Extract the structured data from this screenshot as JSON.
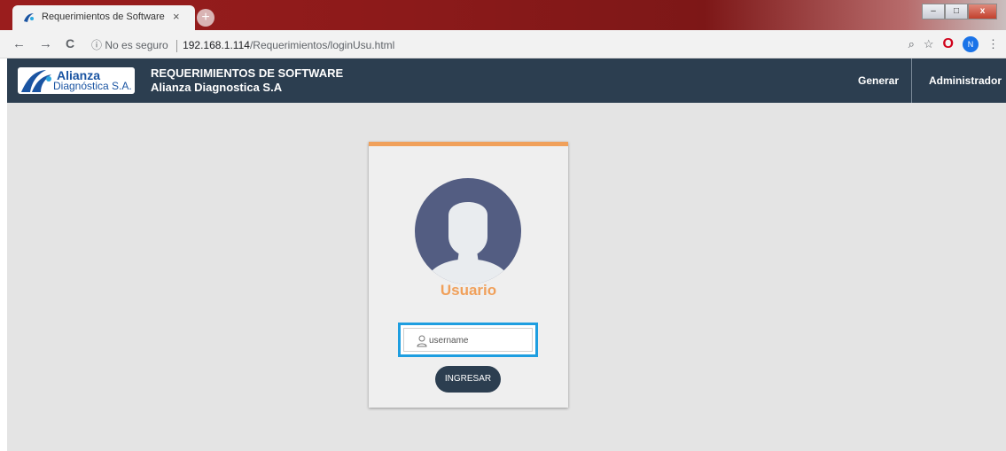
{
  "browser": {
    "tab_title": "Requerimientos de Software",
    "tab_close": "×",
    "new_tab": "+",
    "nav": {
      "back": "←",
      "forward": "→",
      "reload": "C"
    },
    "security_icon": "ⓘ",
    "security_text": "No es seguro",
    "url_host": "192.168.1.114",
    "url_path": "/Requerimientos/loginUsu.html",
    "zoom_icon": "⌕",
    "star_icon": "☆",
    "opera_icon": "O",
    "profile_initial": "N",
    "menu_icon": "⋮",
    "window_controls": {
      "minimize": "–",
      "maximize": "□",
      "close": "x"
    }
  },
  "header": {
    "logo_line1": "Alianza",
    "logo_line2": "Diagnóstica S.A.",
    "title_line1": "REQUERIMIENTOS DE SOFTWARE",
    "title_line2": "Alianza Diagnostica S.A",
    "nav": [
      {
        "label": "Generar"
      },
      {
        "label": "Administrador"
      }
    ]
  },
  "login": {
    "heading": "Usuario",
    "username_placeholder": "username",
    "username_value": "",
    "submit_label": "INGRESAR"
  },
  "colors": {
    "header_bg": "#2c3e50",
    "accent_orange": "#f0a05a",
    "focus_blue": "#1e9ee0",
    "page_bg": "#e4e4e4",
    "avatar_bg": "#535d82"
  }
}
